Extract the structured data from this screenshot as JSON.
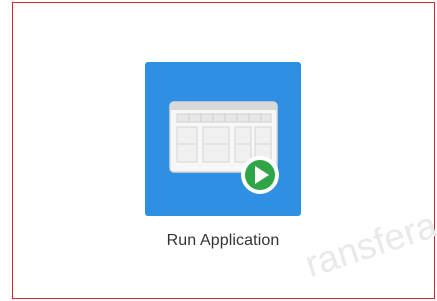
{
  "app": {
    "label": "Run Application",
    "tile_color": "#2f8fe3",
    "badge_color": "#2fa548",
    "icon": "play-icon"
  },
  "watermark": {
    "text": "ransfera"
  },
  "frame": {
    "border_color": "#d4232b"
  }
}
